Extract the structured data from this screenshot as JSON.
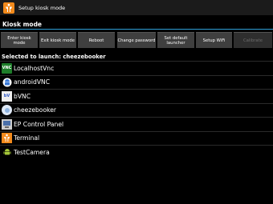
{
  "titlebar": {
    "title": "Setup kiosk mode",
    "icon": "kiosk-app-icon"
  },
  "section": {
    "title": "Kiosk mode"
  },
  "buttons": [
    {
      "label": "Enter kiosk mode",
      "enabled": true
    },
    {
      "label": "Exit kiosk mode",
      "enabled": true
    },
    {
      "label": "Reboot",
      "enabled": true
    },
    {
      "label": "Change password",
      "enabled": true
    },
    {
      "label": "Set default launcher",
      "enabled": true
    },
    {
      "label": "Setup WiFi",
      "enabled": true
    },
    {
      "label": "Calibrate",
      "enabled": false
    }
  ],
  "selected_text": "Selected to launch: cheezebooker",
  "apps": [
    {
      "label": "LocalhostVnc",
      "icon": "vnc-icon"
    },
    {
      "label": "androidVNC",
      "icon": "android-icon"
    },
    {
      "label": "bVNC",
      "icon": "bvnc-icon"
    },
    {
      "label": "cheezebooker",
      "icon": "cheezebooker-icon"
    },
    {
      "label": "EP Control Panel",
      "icon": "control-panel-icon"
    },
    {
      "label": "Terminal",
      "icon": "terminal-icon"
    },
    {
      "label": "TestCamera",
      "icon": "android-icon"
    }
  ],
  "colors": {
    "accent": "#2f9fd6",
    "button": "#3f3f3f",
    "brand": "#f28a1c"
  }
}
